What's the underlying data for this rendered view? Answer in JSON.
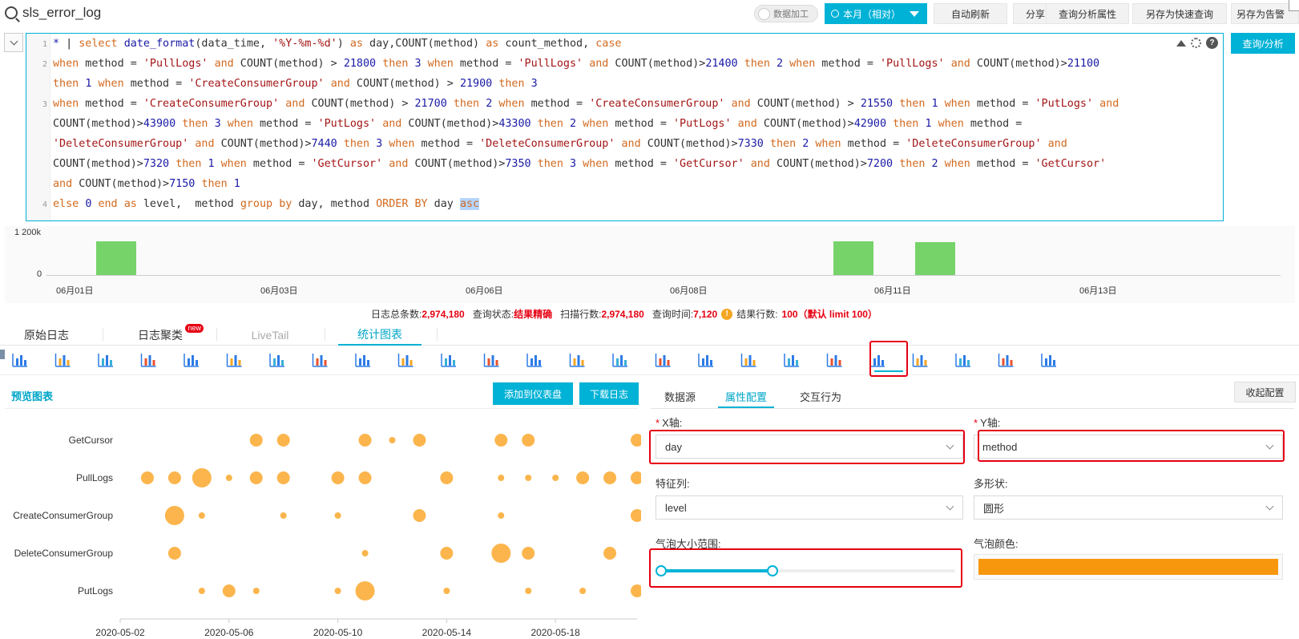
{
  "header": {
    "title": "sls_error_log",
    "toggle_label": "数据加工",
    "time_range": "本月（相对）",
    "buttons": [
      "自动刷新",
      "分享",
      "查询分析属性",
      "另存为快速查询",
      "另存为告警"
    ]
  },
  "query": {
    "submit_label": "查询/分析",
    "line_numbers": [
      "1",
      "2",
      "3",
      "4"
    ]
  },
  "histogram": {
    "y_labels": [
      "1 200k",
      "0"
    ],
    "x_labels": [
      "06月01日",
      "06月03日",
      "06月06日",
      "06月08日",
      "06月11日",
      "06月13日"
    ],
    "bars": [
      {
        "position": "06月01日",
        "height_fraction": 0.86
      },
      {
        "position": "06月10日",
        "height_fraction": 0.86
      },
      {
        "position": "06月11日",
        "height_fraction": 0.84
      }
    ]
  },
  "stats": {
    "total_label": "日志总条数:",
    "total_value": "2,974,180",
    "status_label": "查询状态:",
    "status_value": "结果精确",
    "scan_label": "扫描行数:",
    "scan_value": "2,974,180",
    "time_label": "查询时间:",
    "time_value": "7,120",
    "result_label": "结果行数:",
    "result_value": "100（默认 limit 100）"
  },
  "tabs": {
    "raw": "原始日志",
    "cluster": "日志聚类",
    "cluster_badge": "new",
    "livetail": "LiveTail",
    "chart": "统计图表"
  },
  "chart_types": [
    "table-icon",
    "line-chart-icon",
    "bar-chart-icon",
    "horizontal-bar-icon",
    "pie-chart-icon",
    "area-chart-icon",
    "single-value-icon",
    "progress-bar-icon",
    "map-icon",
    "china-map-icon",
    "world-map-icon",
    "amap-icon",
    "flow-chart-icon",
    "sankey-icon",
    "topology-icon",
    "word-cloud-icon",
    "treemap-icon",
    "funnel-icon",
    "log-chart-icon",
    "compare-icon",
    "bubble-chart-icon",
    "cross-table-icon",
    "gantt-icon",
    "calendar-icon",
    "pin-map-icon"
  ],
  "preview": {
    "title": "预览图表",
    "add_dashboard": "添加到仪表盘",
    "download_log": "下载日志"
  },
  "config": {
    "tabs": [
      "数据源",
      "属性配置",
      "交互行为"
    ],
    "collapse_label": "收起配置",
    "x_axis_label": "X轴:",
    "x_axis_value": "day",
    "y_axis_label": "Y轴:",
    "y_axis_value": "method",
    "feature_label": "特征列:",
    "feature_value": "level",
    "shape_label": "多形状:",
    "shape_value": "圆形",
    "bubble_size_label": "气泡大小范围:",
    "bubble_size_range": [
      10,
      50
    ],
    "bubble_color_label": "气泡颜色:",
    "bubble_color": "#f7970e"
  },
  "colors": {
    "accent": "#00b2d6",
    "bubble": "#fbb54c",
    "histogram_bar": "#76d36a",
    "alert_red": "#e60012"
  },
  "chart_data": {
    "type": "scatter",
    "xlabel": "",
    "ylabel": "",
    "x_ticks": [
      "2020-05-02",
      "2020-05-06",
      "2020-05-10",
      "2020-05-14",
      "2020-05-18"
    ],
    "categories": [
      "GetCursor",
      "PullLogs",
      "CreateConsumerGroup",
      "DeleteConsumerGroup",
      "PutLogs"
    ],
    "xlim": [
      "2020-05-02",
      "2020-05-21"
    ],
    "series": [
      {
        "method": "GetCursor",
        "points": [
          [
            "2020-05-07",
            2
          ],
          [
            "2020-05-08",
            2
          ],
          [
            "2020-05-11",
            2
          ],
          [
            "2020-05-12",
            0
          ],
          [
            "2020-05-13",
            2
          ],
          [
            "2020-05-16",
            2
          ],
          [
            "2020-05-17",
            1
          ],
          [
            "2020-05-21",
            1
          ]
        ]
      },
      {
        "method": "PullLogs",
        "points": [
          [
            "2020-05-03",
            2
          ],
          [
            "2020-05-04",
            2
          ],
          [
            "2020-05-05",
            3
          ],
          [
            "2020-05-06",
            0
          ],
          [
            "2020-05-07",
            2
          ],
          [
            "2020-05-08",
            2
          ],
          [
            "2020-05-10",
            2
          ],
          [
            "2020-05-11",
            1
          ],
          [
            "2020-05-14",
            2
          ],
          [
            "2020-05-16",
            0
          ],
          [
            "2020-05-17",
            0
          ],
          [
            "2020-05-18",
            0
          ],
          [
            "2020-05-19",
            2
          ],
          [
            "2020-05-20",
            1
          ],
          [
            "2020-05-21",
            1
          ]
        ]
      },
      {
        "method": "CreateConsumerGroup",
        "points": [
          [
            "2020-05-04",
            3
          ],
          [
            "2020-05-05",
            0
          ],
          [
            "2020-05-08",
            0
          ],
          [
            "2020-05-10",
            0
          ],
          [
            "2020-05-13",
            2
          ],
          [
            "2020-05-16",
            0
          ],
          [
            "2020-05-21",
            2
          ]
        ]
      },
      {
        "method": "DeleteConsumerGroup",
        "points": [
          [
            "2020-05-04",
            2
          ],
          [
            "2020-05-11",
            0
          ],
          [
            "2020-05-14",
            2
          ],
          [
            "2020-05-16",
            3
          ],
          [
            "2020-05-17",
            2
          ],
          [
            "2020-05-20",
            2
          ]
        ]
      },
      {
        "method": "PutLogs",
        "points": [
          [
            "2020-05-05",
            0
          ],
          [
            "2020-05-06",
            2
          ],
          [
            "2020-05-07",
            0
          ],
          [
            "2020-05-10",
            0
          ],
          [
            "2020-05-11",
            3
          ],
          [
            "2020-05-14",
            0
          ],
          [
            "2020-05-17",
            0
          ],
          [
            "2020-05-19",
            0
          ],
          [
            "2020-05-21",
            1
          ]
        ]
      }
    ]
  }
}
